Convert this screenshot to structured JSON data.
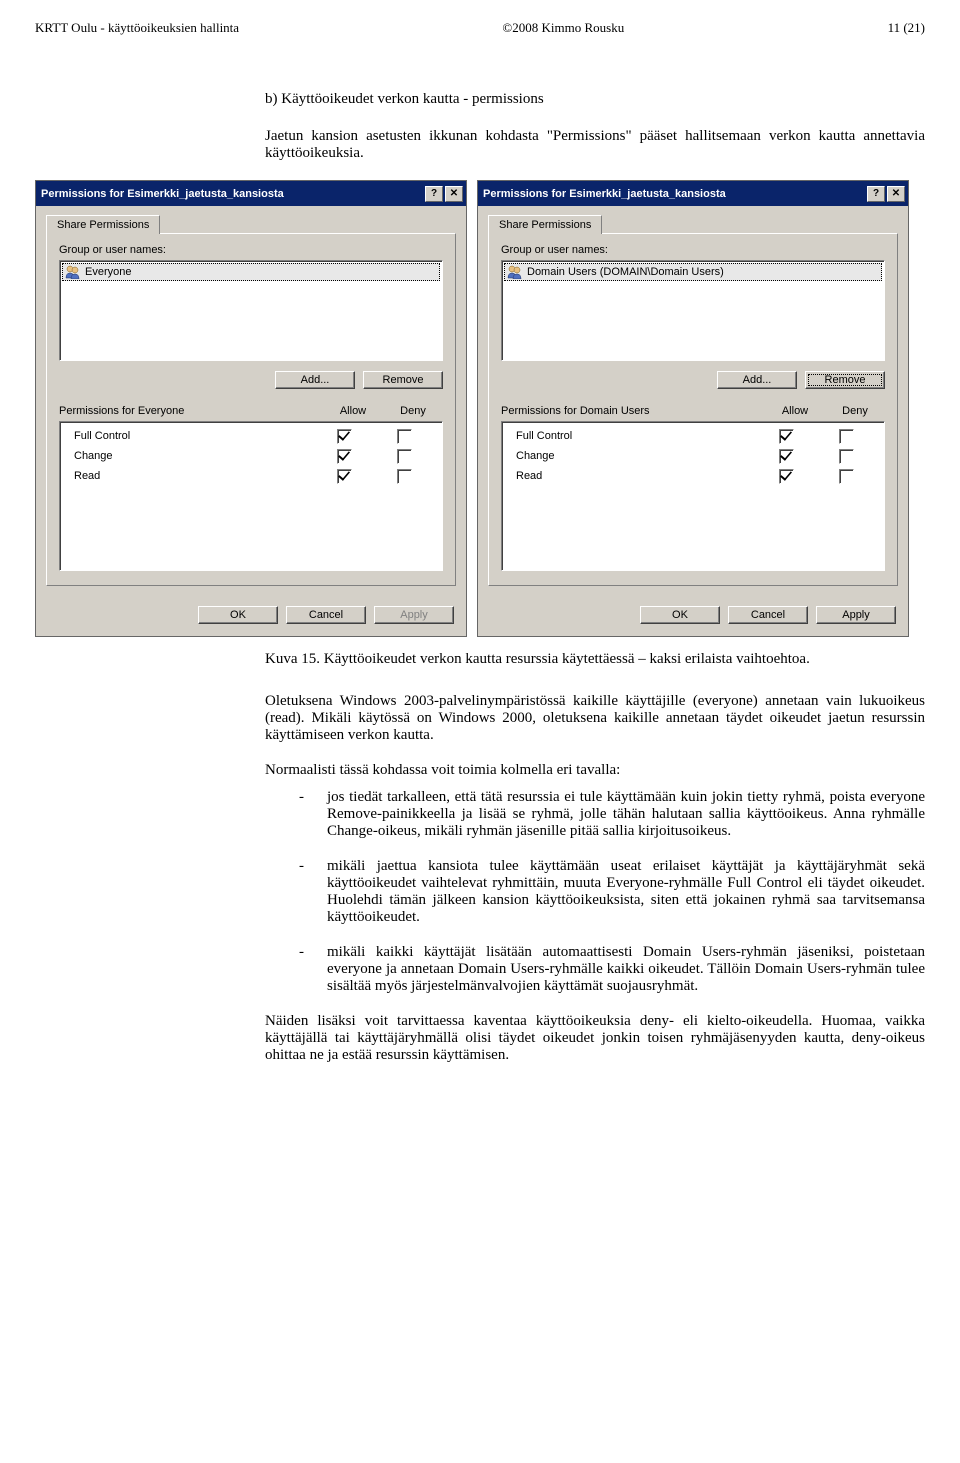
{
  "header": {
    "left": "KRTT Oulu - käyttöoikeuksien hallinta",
    "center": "©2008 Kimmo Rousku",
    "right": "11 (21)"
  },
  "section": {
    "title": "b) Käyttöoikeudet verkon kautta - permissions",
    "intro": "Jaetun kansion asetusten ikkunan kohdasta \"Permissions\" pääset hallitsemaan verkon kautta annettavia käyttöoikeuksia."
  },
  "dialogs": {
    "left": {
      "title": "Permissions for Esimerkki_jaetusta_kansiosta",
      "tab": "Share Permissions",
      "group_label": "Group or user names:",
      "principal": "Everyone",
      "add": "Add...",
      "remove": "Remove",
      "perm_label": "Permissions for Everyone",
      "allow": "Allow",
      "deny": "Deny",
      "perms": {
        "full": "Full Control",
        "change": "Change",
        "read": "Read"
      },
      "ok": "OK",
      "cancel": "Cancel",
      "apply": "Apply"
    },
    "right": {
      "title": "Permissions for Esimerkki_jaetusta_kansiosta",
      "tab": "Share Permissions",
      "group_label": "Group or user names:",
      "principal": "Domain Users (DOMAIN\\Domain Users)",
      "add": "Add...",
      "remove": "Remove",
      "perm_label": "Permissions for Domain Users",
      "allow": "Allow",
      "deny": "Deny",
      "perms": {
        "full": "Full Control",
        "change": "Change",
        "read": "Read"
      },
      "ok": "OK",
      "cancel": "Cancel",
      "apply": "Apply"
    }
  },
  "caption": "Kuva 15. Käyttöoikeudet verkon kautta resurssia käytettäessä – kaksi erilaista vaihtoehtoa.",
  "paragraphs": {
    "p1": "Oletuksena Windows 2003-palvelinympäristössä kaikille käyttäjille (everyone) annetaan vain lukuoikeus (read). Mikäli käytössä on Windows 2000, oletuksena kaikille annetaan täydet oikeudet jaetun resurssin käyttämiseen verkon kautta.",
    "p2": "Normaalisti tässä kohdassa voit toimia kolmella eri tavalla:"
  },
  "bullets": {
    "b1": "jos tiedät tarkalleen, että tätä resurssia ei tule käyttämään kuin jokin tietty ryhmä, poista everyone Remove-painikkeella ja lisää se ryhmä, jolle tähän halutaan sallia käyttöoikeus. Anna ryhmälle Change-oikeus, mikäli ryhmän jäsenille pitää sallia kirjoitusoikeus.",
    "b2": "mikäli jaettua kansiota tulee käyttämään useat erilaiset käyttäjät ja käyttäjäryhmät sekä käyttöoikeudet vaihtelevat ryhmittäin, muuta Everyone-ryhmälle Full Control eli täydet oikeudet. Huolehdi tämän jälkeen kansion käyttöoikeuksista, siten että jokainen ryhmä saa tarvitsemansa käyttöoikeudet.",
    "b3": "mikäli kaikki käyttäjät lisätään automaattisesti Domain Users-ryhmän jäseniksi, poistetaan everyone ja annetaan Domain Users-ryhmälle kaikki oikeudet. Tällöin Domain Users-ryhmän tulee sisältää myös järjestelmänvalvojien käyttämät suojausryhmät."
  },
  "closing": "Näiden lisäksi voit tarvittaessa kaventaa käyttöoikeuksia deny- eli kielto-oikeudella. Huomaa, vaikka käyttäjällä tai käyttäjäryhmällä olisi täydet oikeudet jonkin toisen ryhmäjäsenyyden kautta, deny-oikeus ohittaa ne ja estää resurssin käyttämisen."
}
